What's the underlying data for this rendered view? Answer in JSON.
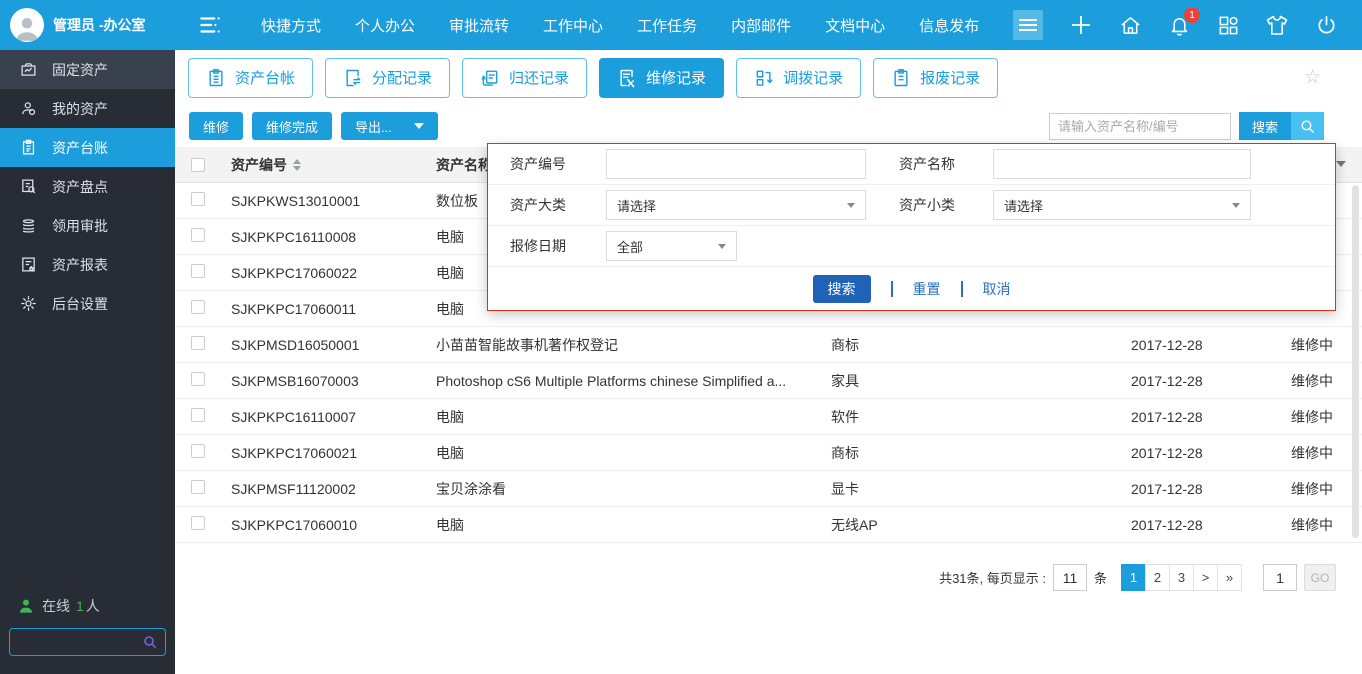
{
  "topbar": {
    "user": "管理员 -办公室",
    "nav": [
      "快捷方式",
      "个人办公",
      "审批流转",
      "工作中心",
      "工作任务",
      "内部邮件",
      "文档中心",
      "信息发布"
    ],
    "notification_badge": "1"
  },
  "sidebar": {
    "items": [
      {
        "label": "固定资产"
      },
      {
        "label": "我的资产"
      },
      {
        "label": "资产台账"
      },
      {
        "label": "资产盘点"
      },
      {
        "label": "领用审批"
      },
      {
        "label": "资产报表"
      },
      {
        "label": "后台设置"
      }
    ],
    "online_label": "在线",
    "online_count": "1",
    "online_suffix": "人"
  },
  "tabs": [
    {
      "label": "资产台帐"
    },
    {
      "label": "分配记录"
    },
    {
      "label": "归还记录"
    },
    {
      "label": "维修记录"
    },
    {
      "label": "调拨记录"
    },
    {
      "label": "报废记录"
    }
  ],
  "toolbar": {
    "repair": "维修",
    "repair_done": "维修完成",
    "export": "导出...",
    "search_placeholder": "请输入资产名称/编号",
    "search": "搜索"
  },
  "table": {
    "headers": {
      "code": "资产编号",
      "name": "资产名称"
    },
    "rows": [
      {
        "code": "SJKPKWS13010001",
        "name": "数位板",
        "category": "",
        "date": "",
        "status": ""
      },
      {
        "code": "SJKPKPC16110008",
        "name": "电脑",
        "category": "",
        "date": "",
        "status": ""
      },
      {
        "code": "SJKPKPC17060022",
        "name": "电脑",
        "category": "",
        "date": "",
        "status": ""
      },
      {
        "code": "SJKPKPC17060011",
        "name": "电脑",
        "category": "",
        "date": "",
        "status": ""
      },
      {
        "code": "SJKPMSD16050001",
        "name": "小苗苗智能故事机著作权登记",
        "category": "商标",
        "date": "2017-12-28",
        "status": "维修中"
      },
      {
        "code": "SJKPMSB16070003",
        "name": "Photoshop cS6 Multiple Platforms chinese Simplified a...",
        "category": "家具",
        "date": "2017-12-28",
        "status": "维修中"
      },
      {
        "code": "SJKPKPC16110007",
        "name": "电脑",
        "category": "软件",
        "date": "2017-12-28",
        "status": "维修中"
      },
      {
        "code": "SJKPKPC17060021",
        "name": "电脑",
        "category": "商标",
        "date": "2017-12-28",
        "status": "维修中"
      },
      {
        "code": "SJKPMSF11120002",
        "name": "宝贝涂涂看",
        "category": "显卡",
        "date": "2017-12-28",
        "status": "维修中"
      },
      {
        "code": "SJKPKPC17060010",
        "name": "电脑",
        "category": "无线AP",
        "date": "2017-12-28",
        "status": "维修中"
      }
    ]
  },
  "popup": {
    "code_label": "资产编号",
    "name_label": "资产名称",
    "major_label": "资产大类",
    "minor_label": "资产小类",
    "date_label": "报修日期",
    "select_placeholder": "请选择",
    "date_value": "全部",
    "search": "搜索",
    "reset": "重置",
    "cancel": "取消"
  },
  "pagination": {
    "total_text": "共31条, 每页显示 :",
    "page_size": "11",
    "unit": "条",
    "pages": [
      "1",
      "2",
      "3",
      ">",
      "»"
    ],
    "goto_value": "1",
    "go_label": "GO"
  },
  "colors": {
    "primary_blue": "#1b9edb",
    "light_blue": "#47c2f0",
    "deep_blue": "#1e63b8",
    "popup_border_red": "#df2b22",
    "badge_red": "#e8433c",
    "sidebar_bg": "#272c35",
    "online_green": "#3cb857"
  }
}
